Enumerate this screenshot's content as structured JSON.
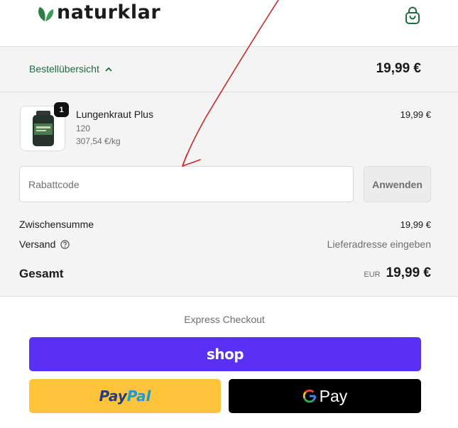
{
  "header": {
    "brand": "naturklar",
    "cart_icon": "shopping-bag-icon"
  },
  "summary": {
    "toggle_label": "Bestellübersicht",
    "toggle_icon": "chevron-up-icon",
    "total": "19,99 €"
  },
  "product": {
    "quantity": "1",
    "name": "Lungenkraut Plus",
    "variant": "120",
    "unit_price": "307,54 €/kg",
    "price": "19,99 €"
  },
  "discount": {
    "placeholder": "Rabattcode",
    "value": "",
    "apply_label": "Anwenden"
  },
  "totals": {
    "subtotal_label": "Zwischensumme",
    "subtotal_value": "19,99 €",
    "shipping_label": "Versand",
    "shipping_icon": "question-circle-icon",
    "shipping_value": "Lieferadresse eingeben",
    "total_label": "Gesamt",
    "currency": "EUR",
    "total_value": "19,99 €"
  },
  "express": {
    "label": "Express Checkout",
    "shop_label": "shop",
    "paypal_part1": "Pay",
    "paypal_part2": "Pal",
    "gpay_label": "Pay"
  },
  "colors": {
    "brand_green": "#1f6b3f",
    "shop_purple": "#5a31f4",
    "paypal_yellow": "#ffc439",
    "annotation_red": "#c8282a"
  }
}
